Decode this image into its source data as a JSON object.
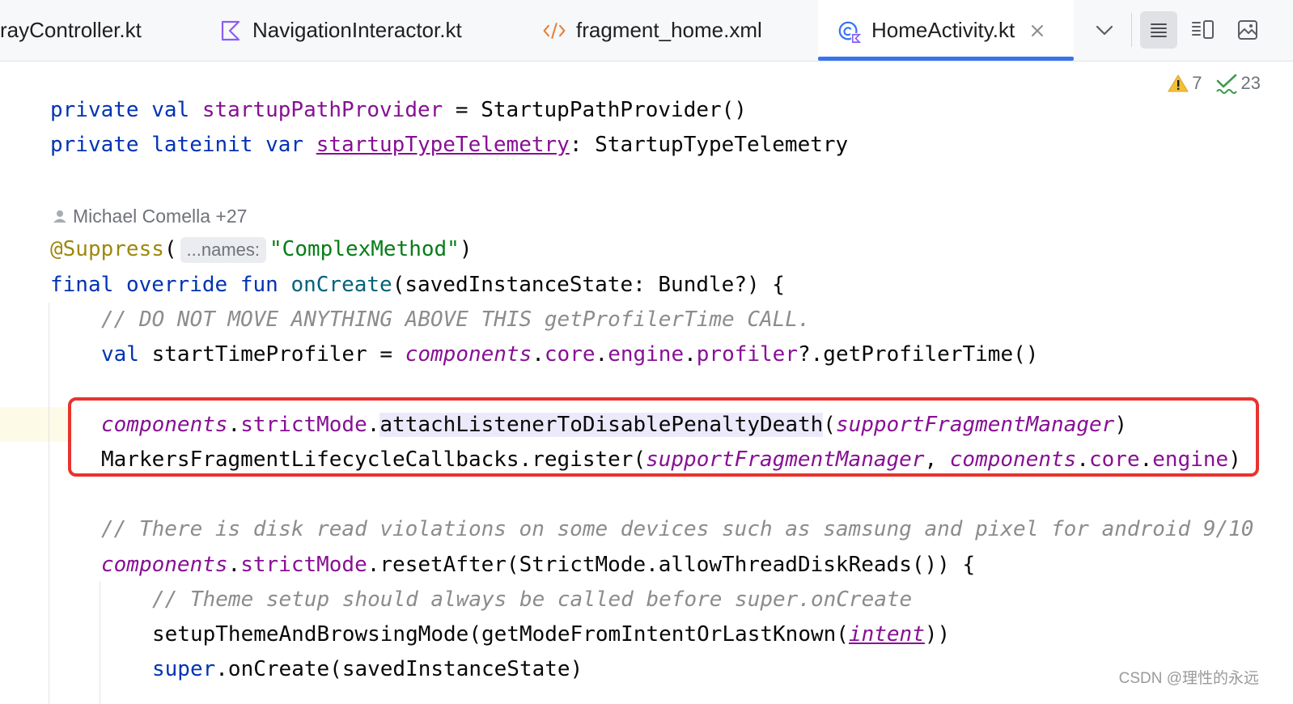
{
  "tabs": [
    {
      "label": "rayController.kt",
      "icon": "kotlin-file-icon"
    },
    {
      "label": "NavigationInteractor.kt",
      "icon": "kotlin-interface-icon"
    },
    {
      "label": "fragment_home.xml",
      "icon": "xml-file-icon"
    },
    {
      "label": "HomeActivity.kt",
      "icon": "kotlin-class-icon",
      "active": true
    }
  ],
  "toolbar": {
    "tab_list_icon": "chevron-down-icon",
    "code_view_icon": "code-view-icon",
    "split_view_icon": "split-view-icon",
    "preview_icon": "preview-icon"
  },
  "inspections": {
    "warnings": "7",
    "typos": "23"
  },
  "code": {
    "l1": {
      "k1": "private",
      "k2": "val",
      "name": "startupPathProvider",
      "rest": " = StartupPathProvider()"
    },
    "l2": {
      "k1": "private",
      "k2": "lateinit",
      "k3": "var",
      "name": "startupTypeTelemetry",
      "rest": ": StartupTypeTelemetry"
    },
    "author": "Michael Comella +27",
    "l3": {
      "ann": "@Suppress",
      "open": "(",
      "hint": "...names:",
      "str": "\"ComplexMethod\"",
      "close": ")"
    },
    "l4": {
      "k1": "final",
      "k2": "override",
      "k3": "fun",
      "fn": "onCreate",
      "rest": "(savedInstanceState: Bundle?) {"
    },
    "l5": {
      "comment": "// DO NOT MOVE ANYTHING ABOVE THIS getProfilerTime CALL."
    },
    "l6": {
      "kw": "val",
      "a": " startTimeProfiler = ",
      "b": "components",
      "c": ".",
      "d": "core",
      "e": ".",
      "f": "engine",
      "g": ".",
      "h": "profiler",
      "i": "?.getProfilerTime()"
    },
    "l7": {
      "a": "components",
      "b": ".",
      "c": "strictMode",
      "d": ".",
      "e": "attachListenerToDisablePenaltyDeath",
      "f": "(",
      "g": "supportFragmentManager",
      "h": ")"
    },
    "l8": {
      "a": "MarkersFragmentLifecycleCallbacks.register(",
      "b": "supportFragmentManager",
      "c": ", ",
      "d": "components",
      "e": ".",
      "f": "core",
      "g": ".",
      "h": "engine",
      "i": ")"
    },
    "l9": {
      "comment": "// There is disk read violations on some devices such as samsung and pixel for android 9/10"
    },
    "l10": {
      "a": "components",
      "b": ".",
      "c": "strictMode",
      "d": ".resetAfter(StrictMode.allowThreadDiskReads()) {"
    },
    "l11": {
      "comment": "// Theme setup should always be called before super.onCreate"
    },
    "l12": {
      "a": "setupThemeAndBrowsingMode(getModeFromIntentOrLastKnown(",
      "b": "intent",
      "c": "))"
    },
    "l13": {
      "a": "super",
      "b": ".onCreate(savedInstanceState)"
    }
  },
  "watermark": "CSDN @理性的永远",
  "colors": {
    "accent": "#3574f0",
    "highlight_border": "#e8332e",
    "keyword": "#0033b3",
    "property": "#871094"
  }
}
